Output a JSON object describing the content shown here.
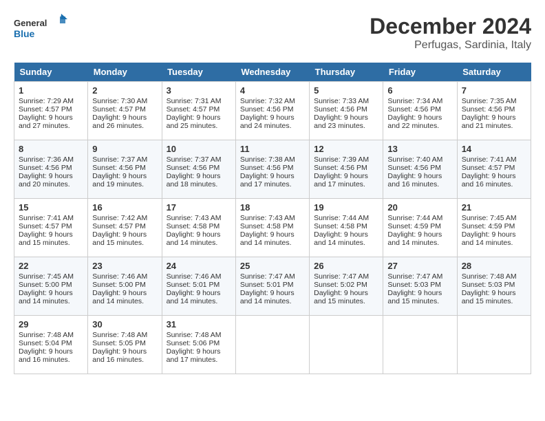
{
  "header": {
    "logo_general": "General",
    "logo_blue": "Blue",
    "month": "December 2024",
    "location": "Perfugas, Sardinia, Italy"
  },
  "columns": [
    "Sunday",
    "Monday",
    "Tuesday",
    "Wednesday",
    "Thursday",
    "Friday",
    "Saturday"
  ],
  "weeks": [
    [
      {
        "day": "1",
        "lines": [
          "Sunrise: 7:29 AM",
          "Sunset: 4:57 PM",
          "Daylight: 9 hours",
          "and 27 minutes."
        ]
      },
      {
        "day": "2",
        "lines": [
          "Sunrise: 7:30 AM",
          "Sunset: 4:57 PM",
          "Daylight: 9 hours",
          "and 26 minutes."
        ]
      },
      {
        "day": "3",
        "lines": [
          "Sunrise: 7:31 AM",
          "Sunset: 4:57 PM",
          "Daylight: 9 hours",
          "and 25 minutes."
        ]
      },
      {
        "day": "4",
        "lines": [
          "Sunrise: 7:32 AM",
          "Sunset: 4:56 PM",
          "Daylight: 9 hours",
          "and 24 minutes."
        ]
      },
      {
        "day": "5",
        "lines": [
          "Sunrise: 7:33 AM",
          "Sunset: 4:56 PM",
          "Daylight: 9 hours",
          "and 23 minutes."
        ]
      },
      {
        "day": "6",
        "lines": [
          "Sunrise: 7:34 AM",
          "Sunset: 4:56 PM",
          "Daylight: 9 hours",
          "and 22 minutes."
        ]
      },
      {
        "day": "7",
        "lines": [
          "Sunrise: 7:35 AM",
          "Sunset: 4:56 PM",
          "Daylight: 9 hours",
          "and 21 minutes."
        ]
      }
    ],
    [
      {
        "day": "8",
        "lines": [
          "Sunrise: 7:36 AM",
          "Sunset: 4:56 PM",
          "Daylight: 9 hours",
          "and 20 minutes."
        ]
      },
      {
        "day": "9",
        "lines": [
          "Sunrise: 7:37 AM",
          "Sunset: 4:56 PM",
          "Daylight: 9 hours",
          "and 19 minutes."
        ]
      },
      {
        "day": "10",
        "lines": [
          "Sunrise: 7:37 AM",
          "Sunset: 4:56 PM",
          "Daylight: 9 hours",
          "and 18 minutes."
        ]
      },
      {
        "day": "11",
        "lines": [
          "Sunrise: 7:38 AM",
          "Sunset: 4:56 PM",
          "Daylight: 9 hours",
          "and 17 minutes."
        ]
      },
      {
        "day": "12",
        "lines": [
          "Sunrise: 7:39 AM",
          "Sunset: 4:56 PM",
          "Daylight: 9 hours",
          "and 17 minutes."
        ]
      },
      {
        "day": "13",
        "lines": [
          "Sunrise: 7:40 AM",
          "Sunset: 4:56 PM",
          "Daylight: 9 hours",
          "and 16 minutes."
        ]
      },
      {
        "day": "14",
        "lines": [
          "Sunrise: 7:41 AM",
          "Sunset: 4:57 PM",
          "Daylight: 9 hours",
          "and 16 minutes."
        ]
      }
    ],
    [
      {
        "day": "15",
        "lines": [
          "Sunrise: 7:41 AM",
          "Sunset: 4:57 PM",
          "Daylight: 9 hours",
          "and 15 minutes."
        ]
      },
      {
        "day": "16",
        "lines": [
          "Sunrise: 7:42 AM",
          "Sunset: 4:57 PM",
          "Daylight: 9 hours",
          "and 15 minutes."
        ]
      },
      {
        "day": "17",
        "lines": [
          "Sunrise: 7:43 AM",
          "Sunset: 4:58 PM",
          "Daylight: 9 hours",
          "and 14 minutes."
        ]
      },
      {
        "day": "18",
        "lines": [
          "Sunrise: 7:43 AM",
          "Sunset: 4:58 PM",
          "Daylight: 9 hours",
          "and 14 minutes."
        ]
      },
      {
        "day": "19",
        "lines": [
          "Sunrise: 7:44 AM",
          "Sunset: 4:58 PM",
          "Daylight: 9 hours",
          "and 14 minutes."
        ]
      },
      {
        "day": "20",
        "lines": [
          "Sunrise: 7:44 AM",
          "Sunset: 4:59 PM",
          "Daylight: 9 hours",
          "and 14 minutes."
        ]
      },
      {
        "day": "21",
        "lines": [
          "Sunrise: 7:45 AM",
          "Sunset: 4:59 PM",
          "Daylight: 9 hours",
          "and 14 minutes."
        ]
      }
    ],
    [
      {
        "day": "22",
        "lines": [
          "Sunrise: 7:45 AM",
          "Sunset: 5:00 PM",
          "Daylight: 9 hours",
          "and 14 minutes."
        ]
      },
      {
        "day": "23",
        "lines": [
          "Sunrise: 7:46 AM",
          "Sunset: 5:00 PM",
          "Daylight: 9 hours",
          "and 14 minutes."
        ]
      },
      {
        "day": "24",
        "lines": [
          "Sunrise: 7:46 AM",
          "Sunset: 5:01 PM",
          "Daylight: 9 hours",
          "and 14 minutes."
        ]
      },
      {
        "day": "25",
        "lines": [
          "Sunrise: 7:47 AM",
          "Sunset: 5:01 PM",
          "Daylight: 9 hours",
          "and 14 minutes."
        ]
      },
      {
        "day": "26",
        "lines": [
          "Sunrise: 7:47 AM",
          "Sunset: 5:02 PM",
          "Daylight: 9 hours",
          "and 15 minutes."
        ]
      },
      {
        "day": "27",
        "lines": [
          "Sunrise: 7:47 AM",
          "Sunset: 5:03 PM",
          "Daylight: 9 hours",
          "and 15 minutes."
        ]
      },
      {
        "day": "28",
        "lines": [
          "Sunrise: 7:48 AM",
          "Sunset: 5:03 PM",
          "Daylight: 9 hours",
          "and 15 minutes."
        ]
      }
    ],
    [
      {
        "day": "29",
        "lines": [
          "Sunrise: 7:48 AM",
          "Sunset: 5:04 PM",
          "Daylight: 9 hours",
          "and 16 minutes."
        ]
      },
      {
        "day": "30",
        "lines": [
          "Sunrise: 7:48 AM",
          "Sunset: 5:05 PM",
          "Daylight: 9 hours",
          "and 16 minutes."
        ]
      },
      {
        "day": "31",
        "lines": [
          "Sunrise: 7:48 AM",
          "Sunset: 5:06 PM",
          "Daylight: 9 hours",
          "and 17 minutes."
        ]
      },
      null,
      null,
      null,
      null
    ]
  ]
}
